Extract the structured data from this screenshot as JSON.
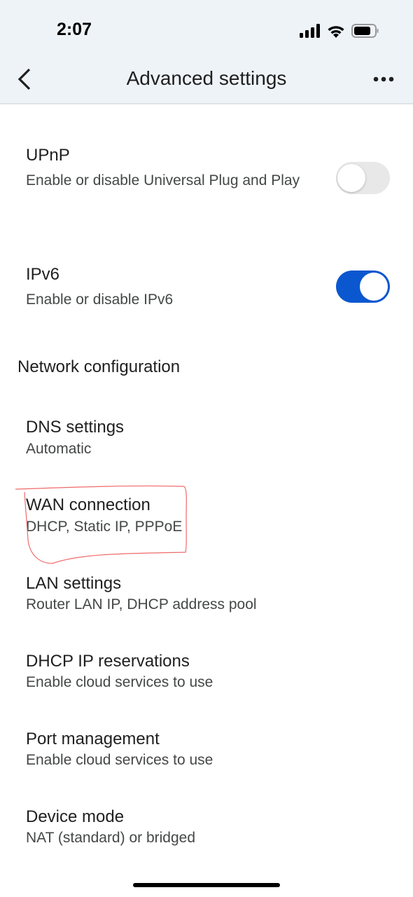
{
  "status_bar": {
    "time": "2:07",
    "icons": [
      "signal-icon",
      "wifi-icon",
      "battery-icon"
    ]
  },
  "header": {
    "title": "Advanced settings",
    "back_icon": "chevron-left-icon",
    "menu_icon": "more-horizontal-icon"
  },
  "toggles": [
    {
      "title": "UPnP",
      "subtitle": "Enable or disable Universal Plug and Play",
      "enabled": false
    },
    {
      "title": "IPv6",
      "subtitle": "Enable or disable IPv6",
      "enabled": true
    }
  ],
  "section": {
    "title": "Network configuration"
  },
  "items": [
    {
      "title": "DNS settings",
      "subtitle": "Automatic"
    },
    {
      "title": "WAN connection",
      "subtitle": "DHCP, Static IP, PPPoE"
    },
    {
      "title": "LAN settings",
      "subtitle": "Router LAN IP, DHCP address pool"
    },
    {
      "title": "DHCP IP reservations",
      "subtitle": "Enable cloud services to use"
    },
    {
      "title": "Port management",
      "subtitle": "Enable cloud services to use"
    },
    {
      "title": "Device mode",
      "subtitle": "NAT (standard) or bridged"
    }
  ],
  "colors": {
    "accent": "#0b57d0",
    "header_bg": "#eef3f8",
    "annotation": "#f06a6a"
  }
}
